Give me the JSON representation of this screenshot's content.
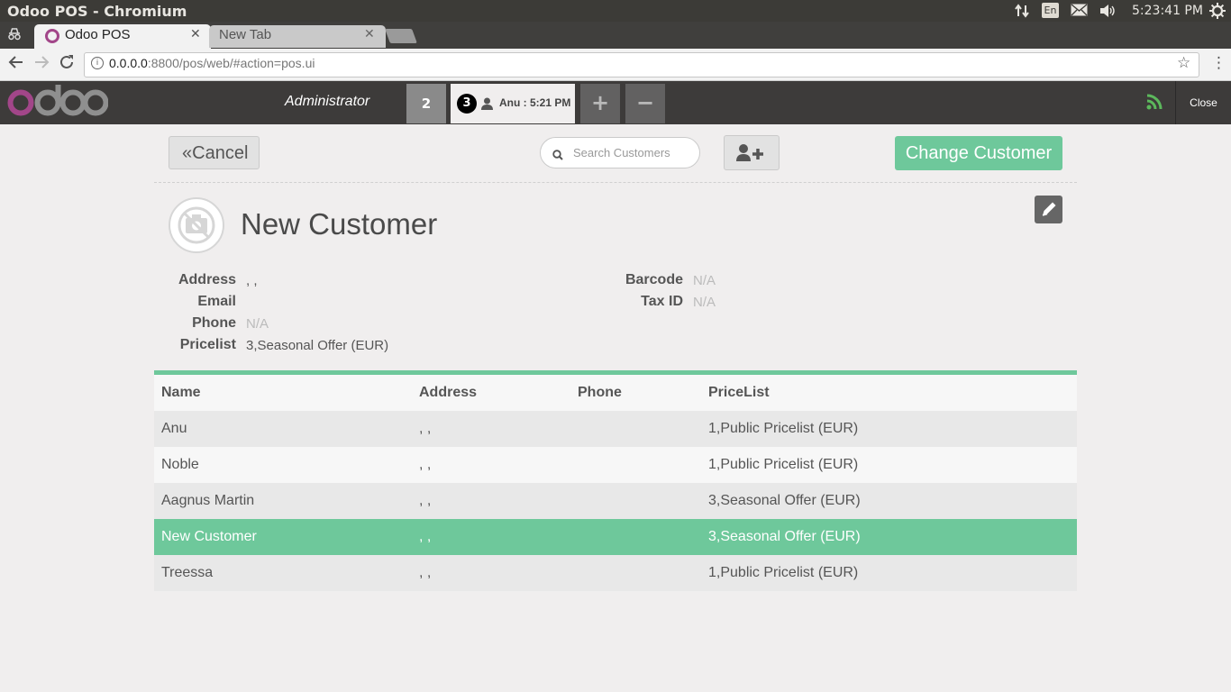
{
  "os": {
    "window_title": "Odoo POS - Chromium",
    "lang": "En",
    "time": "5:23:41 PM"
  },
  "browser": {
    "tabs": [
      {
        "label": "Odoo POS",
        "active": true
      },
      {
        "label": "New Tab",
        "active": false
      }
    ],
    "url_host": "0.0.0.0",
    "url_rest": ":8800/pos/web/#action=pos.ui"
  },
  "pos": {
    "user": "Administrator",
    "orders": [
      {
        "number": "2"
      },
      {
        "number": "3",
        "label": "Anu : 5:21 PM",
        "selected": true
      }
    ],
    "add_order": "+",
    "remove_order": "−",
    "close_label": "Close"
  },
  "customer_screen": {
    "cancel_label": "Cancel",
    "search_placeholder": "Search Customers",
    "change_customer_label": "Change Customer",
    "details": {
      "name": "New Customer",
      "labels": {
        "address": "Address",
        "email": "Email",
        "phone": "Phone",
        "pricelist": "Pricelist",
        "barcode": "Barcode",
        "tax_id": "Tax ID"
      },
      "values": {
        "address": ", ,",
        "email": "",
        "phone": "N/A",
        "pricelist": "3,Seasonal Offer (EUR)",
        "barcode": "N/A",
        "tax_id": "N/A"
      }
    },
    "table": {
      "headers": [
        "Name",
        "Address",
        "Phone",
        "PriceList"
      ],
      "rows": [
        {
          "name": "Anu",
          "address": ", ,",
          "phone": "",
          "pricelist": "1,Public Pricelist (EUR)"
        },
        {
          "name": "Noble",
          "address": ", ,",
          "phone": "",
          "pricelist": "1,Public Pricelist (EUR)"
        },
        {
          "name": "Aagnus Martin",
          "address": ", ,",
          "phone": "",
          "pricelist": "3,Seasonal Offer (EUR)"
        },
        {
          "name": "New Customer",
          "address": ", ,",
          "phone": "",
          "pricelist": "3,Seasonal Offer (EUR)",
          "selected": true
        },
        {
          "name": "Treessa",
          "address": ", ,",
          "phone": "",
          "pricelist": "1,Public Pricelist (EUR)"
        }
      ]
    }
  },
  "colors": {
    "accent_green": "#6ec89b",
    "header_dark": "#3d3b3a",
    "odoo_purple": "#a24689"
  }
}
